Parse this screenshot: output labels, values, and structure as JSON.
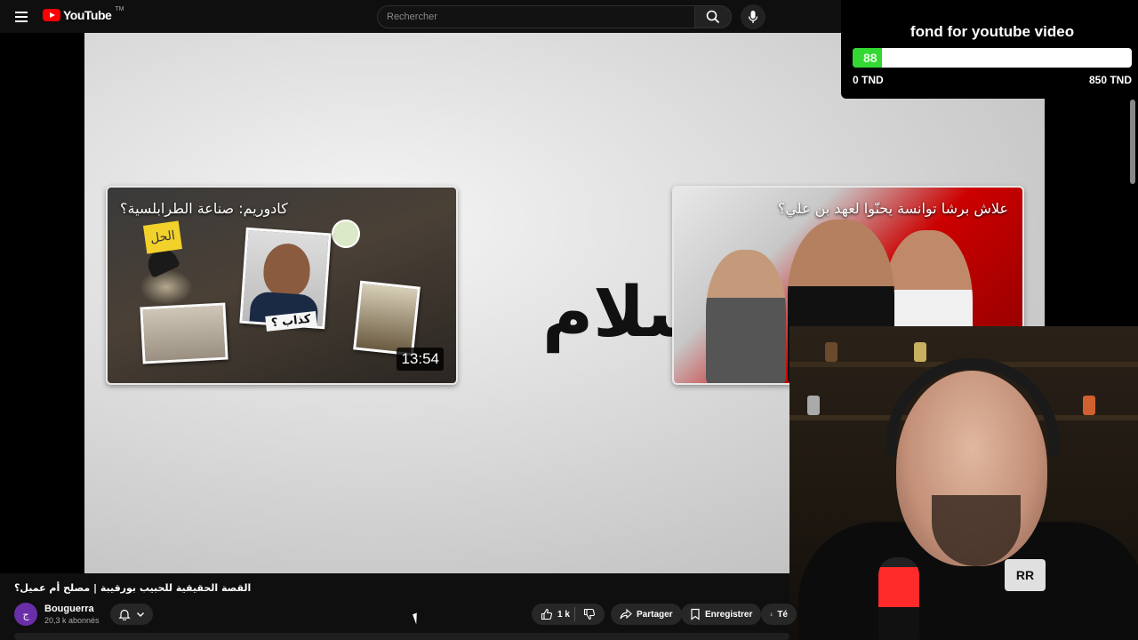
{
  "header": {
    "logo_text": "YouTube",
    "logo_tm": "TM",
    "search_placeholder": "Rechercher"
  },
  "donation": {
    "title": "fond for youtube video",
    "current": 88,
    "min_label": "0 TND",
    "max_label": "850 TND",
    "min": 0,
    "max": 850,
    "fill_color": "#33d833"
  },
  "video": {
    "big_text": "سلام",
    "cards": [
      {
        "title": "كادوريم: صناعة الطرابلسية؟",
        "duration": "13:54",
        "sticky_note": "الحل",
        "tag": "كذاب ؟"
      },
      {
        "title": "علاش برشا توانسة يحنّوا لعهد بن علي؟"
      }
    ]
  },
  "webcam": {
    "patch_text": "RR"
  },
  "info": {
    "title": "القصة الحقيقية للحبيب بورقيبة | مصلح أم عميل؟",
    "channel_name": "Bouguerra",
    "channel_subs": "20,3 k abonnés",
    "like_count": "1 k",
    "share_label": "Partager",
    "save_label": "Enregistrer",
    "download_label": "Té"
  },
  "colors": {
    "brand_red": "#ff0000",
    "background": "#0f0f0f",
    "pill": "#272727"
  }
}
